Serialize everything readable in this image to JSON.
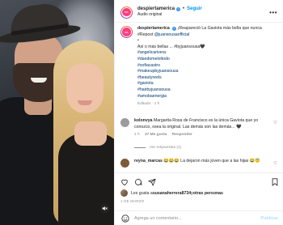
{
  "header": {
    "username": "despiertamerica",
    "follow_label": "Seguir",
    "separator": "•",
    "subtitle": "Audio original",
    "more_label": "•••",
    "avatar_text": "DA"
  },
  "caption": {
    "username": "despiertamerica",
    "line1": "¡Reapareció La Gaviota más bella que nunca",
    "line2_prefix": "#Repost ",
    "line2_link": "@juansousaofficial",
    "line3": "•",
    "line4": "Así o más bellas ... #byjuansousa🖤",
    "hashtags": [
      "#angelicarivera",
      "#dandomeloltodo",
      "#sofiacastro",
      "#makeupbyjuansousa",
      "#beautyreels",
      "#gaviota",
      "#hairbyjuansousa",
      "#amobaenergia"
    ],
    "meta_edited": "Editado",
    "meta_time": "1 h"
  },
  "comments": [
    {
      "username": "kolonvya",
      "text": "Margarita Rosa de Francisco es la única Gaviota que yo conozco, osea la original. Las demás son las demás...",
      "emoji_tail": "🖤",
      "time": "1 h",
      "likes": "37 Me gusta",
      "reply": "Responder",
      "avatar_color": "#9c9c9c"
    },
    {
      "username": "reyna_marcas",
      "text": "😂😂😂 La dejaron más joven que a las hijas 😂😇",
      "avatar_color": "#7d5a3c"
    }
  ],
  "replies_label": "Ver respuestas (1)",
  "likes": {
    "prefix": "Les gusta a ",
    "user": "susanaherrera8734",
    "middle": " y ",
    "others": "otras personas"
  },
  "date": "1 DE MARZO",
  "comment_box": {
    "placeholder": "Agrega un comentario...",
    "publish_label": "Publicar"
  },
  "icons": {
    "sound": "🔇"
  }
}
